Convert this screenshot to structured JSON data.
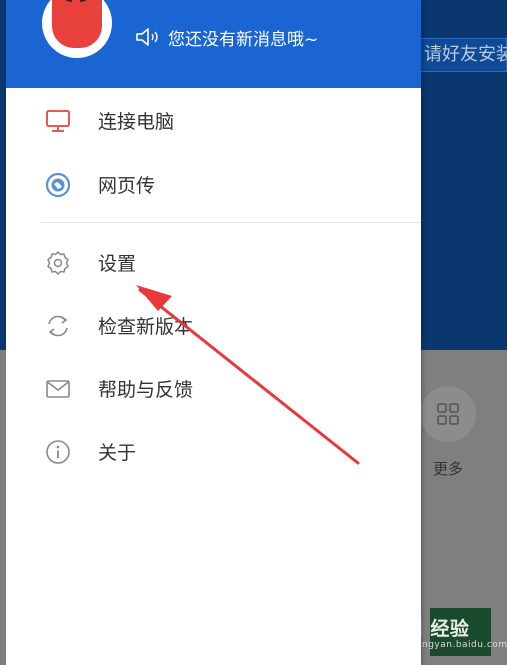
{
  "background": {
    "invite_text": "请好友安装",
    "more_label": "更多"
  },
  "drawer": {
    "notice": "您还没有新消息哦~",
    "menu": [
      {
        "label": "连接电脑",
        "icon": "monitor-icon"
      },
      {
        "label": "网页传",
        "icon": "web-transfer-icon"
      },
      {
        "label": "设置",
        "icon": "gear-icon"
      },
      {
        "label": "检查新版本",
        "icon": "refresh-icon"
      },
      {
        "label": "帮助与反馈",
        "icon": "mail-icon"
      },
      {
        "label": "关于",
        "icon": "info-icon"
      }
    ]
  },
  "watermark": {
    "text": "Bai 经验",
    "sub": "jingyan.baidu.com"
  },
  "colors": {
    "header_blue": "#1a65d2",
    "accent_red": "#e55a4f",
    "arrow_red": "#e8373d"
  }
}
